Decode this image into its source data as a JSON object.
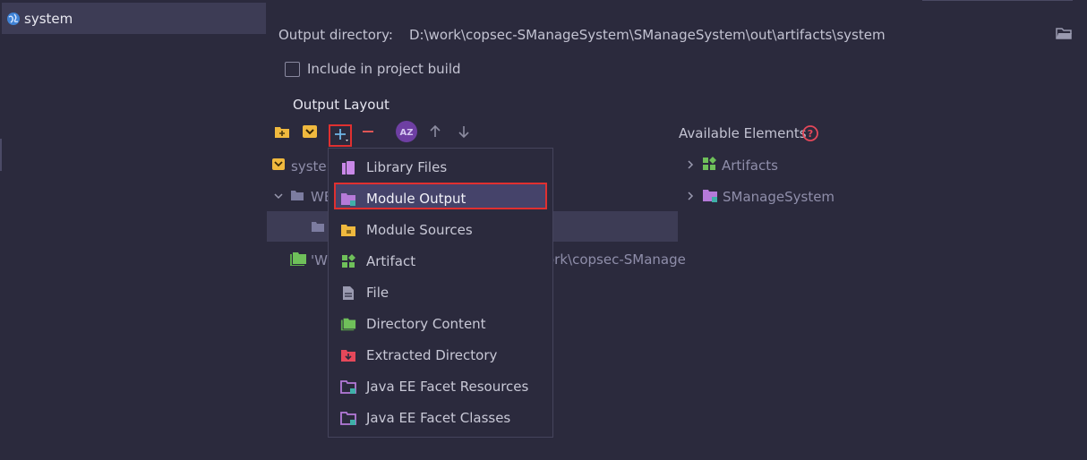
{
  "artifacts_list": {
    "items": [
      {
        "label": "system"
      }
    ]
  },
  "header": {
    "output_dir_label": "Output directory:",
    "output_dir_value": "D:\\work\\copsec-SManageSystem\\SManageSystem\\out\\artifacts\\system",
    "include_build_label": "Include in project build",
    "include_build_checked": false
  },
  "layout": {
    "title": "Output Layout",
    "tree": [
      {
        "label": "syster"
      },
      {
        "label": "WE"
      },
      {
        "label": "'W"
      },
      {
        "label": "ork\\copsec-SManage"
      }
    ]
  },
  "add_menu": {
    "items": [
      {
        "label": "Library Files",
        "icon": "library-icon"
      },
      {
        "label": "Module Output",
        "icon": "module-output-icon"
      },
      {
        "label": "Module Sources",
        "icon": "module-sources-icon"
      },
      {
        "label": "Artifact",
        "icon": "artifact-icon"
      },
      {
        "label": "File",
        "icon": "file-icon"
      },
      {
        "label": "Directory Content",
        "icon": "directory-content-icon"
      },
      {
        "label": "Extracted Directory",
        "icon": "extracted-directory-icon"
      },
      {
        "label": "Java EE Facet Resources",
        "icon": "javaee-resources-icon"
      },
      {
        "label": "Java EE Facet Classes",
        "icon": "javaee-classes-icon"
      }
    ],
    "highlighted": "Module Output"
  },
  "available": {
    "title": "Available Elements",
    "items": [
      {
        "label": "Artifacts"
      },
      {
        "label": "SManageSystem"
      }
    ]
  },
  "colors": {
    "background": "#2b2a3d",
    "selection": "#3d3c55",
    "highlight_border": "#e03030"
  }
}
